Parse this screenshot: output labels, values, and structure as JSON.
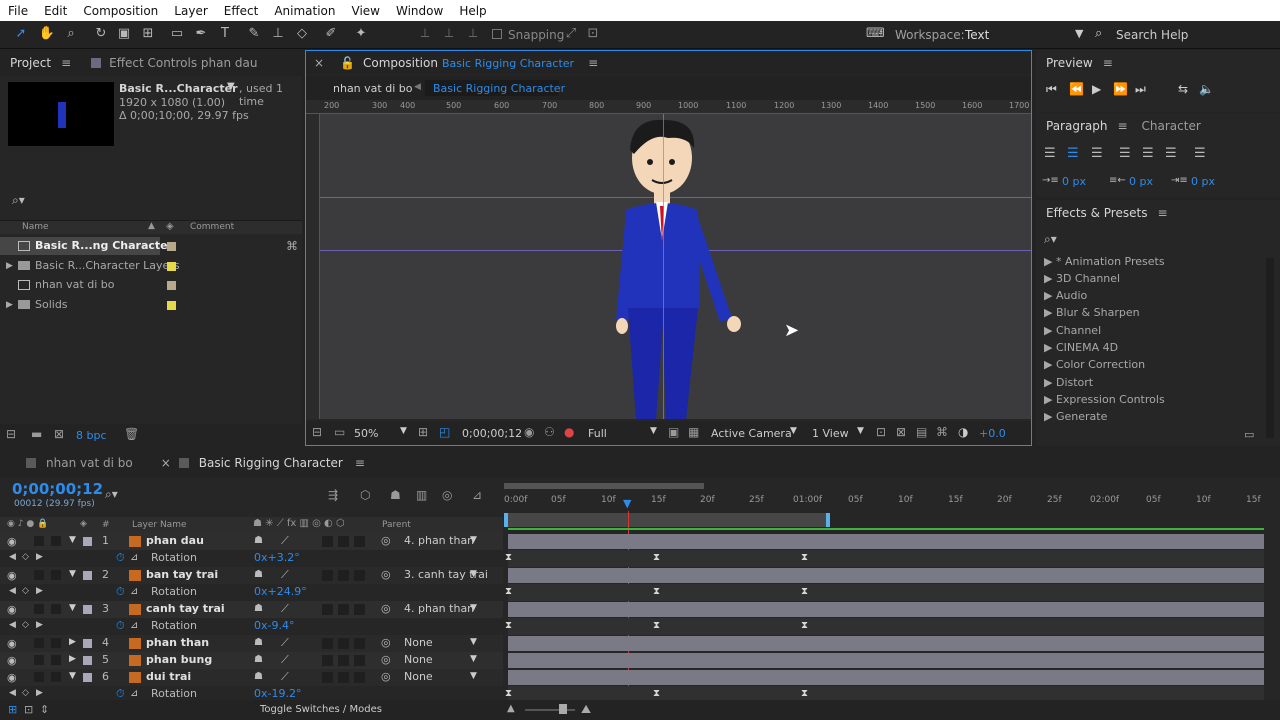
{
  "menu": [
    "File",
    "Edit",
    "Composition",
    "Layer",
    "Effect",
    "Animation",
    "View",
    "Window",
    "Help"
  ],
  "toolbar": {
    "snapping": "Snapping",
    "workspace_label": "Workspace:",
    "workspace_value": "Text",
    "search_help": "Search Help"
  },
  "project": {
    "tab": "Project",
    "effect_controls_tab": "Effect Controls phan dau",
    "selected_name": "Basic R...Character",
    "used": ", used 1 time",
    "dims": "1920 x 1080 (1.00)",
    "duration": "Δ 0;00;10;00, 29.97 fps",
    "col_name": "Name",
    "col_comment": "Comment",
    "items": [
      {
        "name": "Basic R...ng Character",
        "color": "#b8a98a",
        "type": "comp"
      },
      {
        "name": "Basic R...Character Layers",
        "color": "#e5d94a",
        "type": "folder"
      },
      {
        "name": "nhan vat di bo",
        "color": "#b8a98a",
        "type": "comp"
      },
      {
        "name": "Solids",
        "color": "#e5d94a",
        "type": "folder"
      }
    ],
    "bpc": "8 bpc"
  },
  "composition": {
    "tab_prefix": "Composition",
    "tab_name": "Basic Rigging Character",
    "flow_prev": "nhan vat di bo",
    "flow_current": "Basic Rigging Character",
    "ruler": [
      "200",
      "300",
      "400",
      "500",
      "600",
      "700",
      "800",
      "900",
      "1000",
      "1100",
      "1200",
      "1300",
      "1400",
      "1500",
      "1600",
      "1700"
    ],
    "zoom": "50%",
    "timecode": "0;00;00;12",
    "resolution": "Full",
    "camera": "Active Camera",
    "views": "1 View",
    "exposure": "+0.0"
  },
  "preview": {
    "tab": "Preview"
  },
  "paragraph": {
    "tab": "Paragraph",
    "character_tab": "Character",
    "indent_left": "0 px",
    "indent_right": "0 px",
    "indent_first": "0 px"
  },
  "effects": {
    "tab": "Effects & Presets",
    "items": [
      "* Animation Presets",
      "3D Channel",
      "Audio",
      "Blur & Sharpen",
      "Channel",
      "CINEMA 4D",
      "Color Correction",
      "Distort",
      "Expression Controls",
      "Generate"
    ]
  },
  "timeline": {
    "tab1": "nhan vat di bo",
    "tab2": "Basic Rigging Character",
    "timecode": "0;00;00;12",
    "frames": "00012 (29.97 fps)",
    "col_layer_name": "Layer Name",
    "col_hash": "#",
    "col_parent": "Parent",
    "ruler": [
      "0:00f",
      "05f",
      "10f",
      "15f",
      "20f",
      "25f",
      "01:00f",
      "05f",
      "10f",
      "15f",
      "20f",
      "25f",
      "02:00f",
      "05f",
      "10f",
      "15f"
    ],
    "toggle_label": "Toggle Switches / Modes",
    "layers": [
      {
        "num": "1",
        "name": "phan dau",
        "parent": "4. phan than",
        "prop": "Rotation",
        "value": "0x+3.2°",
        "expanded": true
      },
      {
        "num": "2",
        "name": "ban tay trai",
        "parent": "3. canh tay trai",
        "prop": "Rotation",
        "value": "0x+24.9°",
        "expanded": true
      },
      {
        "num": "3",
        "name": "canh tay trai",
        "parent": "4. phan than",
        "prop": "Rotation",
        "value": "0x-9.4°",
        "expanded": true
      },
      {
        "num": "4",
        "name": "phan than",
        "parent": "None",
        "expanded": false
      },
      {
        "num": "5",
        "name": "phan bung",
        "parent": "None",
        "expanded": false
      },
      {
        "num": "6",
        "name": "dui trai",
        "parent": "None",
        "prop": "Rotation",
        "value": "0x-19.2°",
        "expanded": true
      }
    ]
  }
}
